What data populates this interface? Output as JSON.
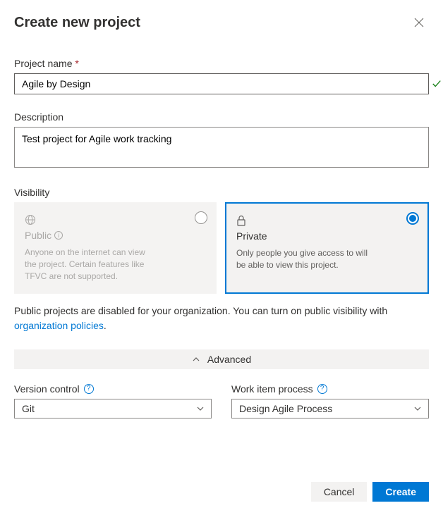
{
  "dialog": {
    "title": "Create new project",
    "close_aria": "Close"
  },
  "fields": {
    "project_name": {
      "label": "Project name",
      "required_marker": "*",
      "value": "Agile by Design"
    },
    "description": {
      "label": "Description",
      "value": "Test project for Agile work tracking"
    },
    "visibility": {
      "label": "Visibility"
    }
  },
  "visibility_options": {
    "public": {
      "title": "Public",
      "description": "Anyone on the internet can view the project. Certain features like TFVC are not supported.",
      "selected": false,
      "enabled": false
    },
    "private": {
      "title": "Private",
      "description": "Only people you give access to will be able to view this project.",
      "selected": true,
      "enabled": true
    }
  },
  "public_disabled_notice": {
    "text_before": "Public projects are disabled for your organization. You can turn on public visibility with ",
    "link_text": "organization policies",
    "text_after": "."
  },
  "advanced": {
    "toggle_label": "Advanced",
    "version_control": {
      "label": "Version control",
      "value": "Git"
    },
    "work_item_process": {
      "label": "Work item process",
      "value": "Design Agile Process"
    }
  },
  "footer": {
    "cancel": "Cancel",
    "create": "Create"
  }
}
